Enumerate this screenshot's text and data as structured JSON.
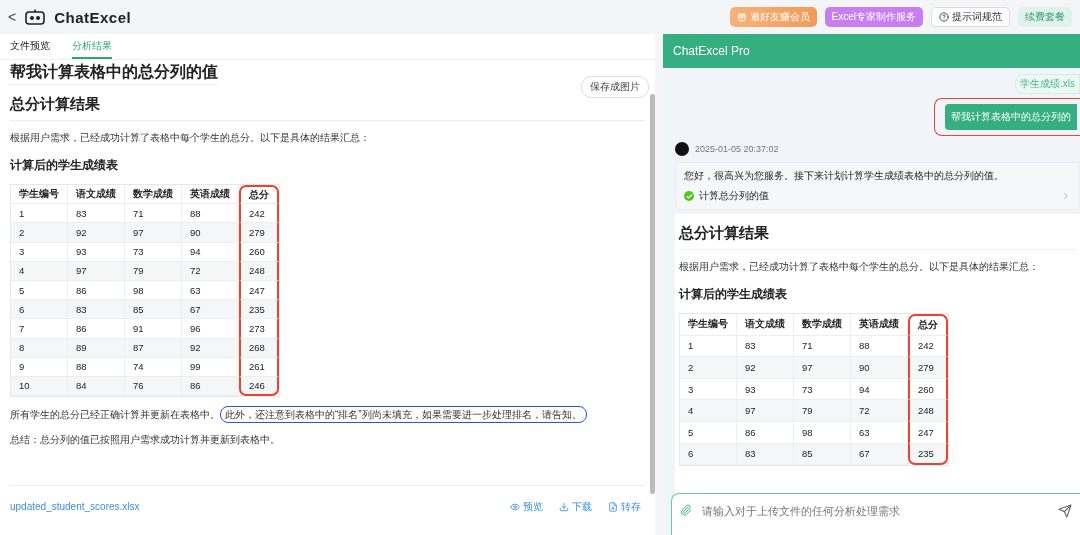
{
  "header": {
    "back": "<",
    "logo": "ChatExcel",
    "buttons": [
      {
        "label": "邀好友赚会员",
        "kind": "invite"
      },
      {
        "label": "Excel专家制作服务",
        "kind": "expert"
      },
      {
        "label": "提示词规范",
        "kind": "help"
      },
      {
        "label": "续费套餐",
        "kind": "renew"
      }
    ]
  },
  "tabs": [
    {
      "label": "文件预览",
      "selected": false
    },
    {
      "label": "分析结果",
      "selected": true
    }
  ],
  "left": {
    "query_title": "帮我计算表格中的总分列的值",
    "save_button": "保存成图片",
    "heading": "总分计算结果",
    "intro": "根据用户需求，已经成功计算了表格中每个学生的总分。以下是具体的结果汇总：",
    "table_title": "计算后的学生成绩表",
    "table": {
      "columns": [
        {
          "label": "学生编号",
          "highlight": false
        },
        {
          "label": "语文成绩",
          "highlight": false
        },
        {
          "label": "数学成绩",
          "highlight": false
        },
        {
          "label": "英语成绩",
          "highlight": false
        },
        {
          "label": "总分",
          "highlight": true
        }
      ],
      "rows": [
        [
          "1",
          "83",
          "71",
          "88",
          "242"
        ],
        [
          "2",
          "92",
          "97",
          "90",
          "279"
        ],
        [
          "3",
          "93",
          "73",
          "94",
          "260"
        ],
        [
          "4",
          "97",
          "79",
          "72",
          "248"
        ],
        [
          "5",
          "86",
          "98",
          "63",
          "247"
        ],
        [
          "6",
          "83",
          "85",
          "67",
          "235"
        ],
        [
          "7",
          "86",
          "91",
          "96",
          "273"
        ],
        [
          "8",
          "89",
          "87",
          "92",
          "268"
        ],
        [
          "9",
          "88",
          "74",
          "99",
          "261"
        ],
        [
          "10",
          "84",
          "76",
          "86",
          "246"
        ]
      ]
    },
    "note": [
      {
        "text": "所有学生的总分已经正确计算并更新在表格中。",
        "circled": false
      },
      {
        "text": "此外，还注意到表格中的“排名”列尚未填充，如果需要进一步处理排名，请告知。",
        "circled": true
      }
    ],
    "summary": "总结：总分列的值已按照用户需求成功计算并更新到表格中。",
    "file": "updated_student_scores.xlsx",
    "actions": [
      {
        "label": "预览",
        "kind": "preview"
      },
      {
        "label": "下载",
        "kind": "download"
      },
      {
        "label": "转存",
        "kind": "save"
      }
    ]
  },
  "chat": {
    "title": "ChatExcel Pro",
    "file_chip": "学生成绩.xls",
    "user_message": "帮我计算表格中的总分列的",
    "user_circled": true,
    "timestamp": "2025-01-05 20:37:02",
    "greeting": "您好，很高兴为您服务。接下来计划计算学生成绩表格中的总分列的值。",
    "step": {
      "label": "计算总分列的值",
      "done": true
    },
    "heading": "总分计算结果",
    "intro": "根据用户需求，已经成功计算了表格中每个学生的总分。以下是具体的结果汇总：",
    "table_title": "计算后的学生成绩表",
    "table": {
      "columns": [
        {
          "label": "学生编号",
          "highlight": false
        },
        {
          "label": "语文成绩",
          "highlight": false
        },
        {
          "label": "数学成绩",
          "highlight": false
        },
        {
          "label": "英语成绩",
          "highlight": false
        },
        {
          "label": "总分",
          "highlight": true
        }
      ],
      "rows": [
        [
          "1",
          "83",
          "71",
          "88",
          "242"
        ],
        [
          "2",
          "92",
          "97",
          "90",
          "279"
        ],
        [
          "3",
          "93",
          "73",
          "94",
          "260"
        ],
        [
          "4",
          "97",
          "79",
          "72",
          "248"
        ],
        [
          "5",
          "86",
          "98",
          "63",
          "247"
        ],
        [
          "6",
          "83",
          "85",
          "67",
          "235"
        ]
      ]
    },
    "input_placeholder": "请输入对于上传文件的任何分析处理需求"
  }
}
